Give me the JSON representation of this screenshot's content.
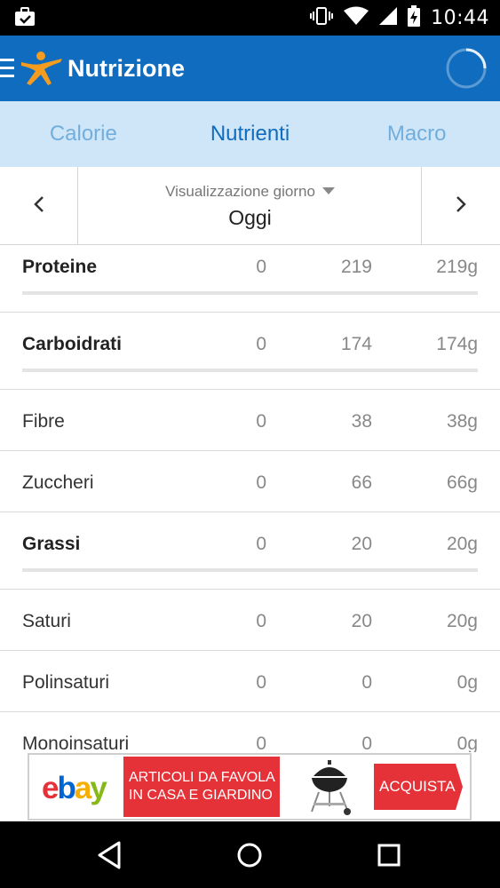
{
  "status_bar": {
    "time": "10:44",
    "icons": [
      "briefcase-check-icon",
      "vibrate-icon",
      "wifi-icon",
      "signal-icon",
      "battery-charging-icon"
    ]
  },
  "app_bar": {
    "title": "Nutrizione",
    "menu_icon": "hamburger-icon",
    "logo_icon": "runner-logo-icon",
    "status_icon": "loading-spinner-icon",
    "color": "#0f6cbf"
  },
  "tabs": [
    {
      "label": "Calorie",
      "active": false
    },
    {
      "label": "Nutrienti",
      "active": true
    },
    {
      "label": "Macro",
      "active": false
    }
  ],
  "day_selector": {
    "label": "Visualizzazione giorno",
    "value": "Oggi"
  },
  "nutrients": [
    {
      "name": "Proteine",
      "total": "0",
      "goal": "219",
      "left": "219g",
      "main": true
    },
    {
      "name": "Carboidrati",
      "total": "0",
      "goal": "174",
      "left": "174g",
      "main": true
    },
    {
      "name": "Fibre",
      "total": "0",
      "goal": "38",
      "left": "38g",
      "main": false
    },
    {
      "name": "Zuccheri",
      "total": "0",
      "goal": "66",
      "left": "66g",
      "main": false
    },
    {
      "name": "Grassi",
      "total": "0",
      "goal": "20",
      "left": "20g",
      "main": true
    },
    {
      "name": "Saturi",
      "total": "0",
      "goal": "20",
      "left": "20g",
      "main": false
    },
    {
      "name": "Polinsaturi",
      "total": "0",
      "goal": "0",
      "left": "0g",
      "main": false
    },
    {
      "name": "Monoinsaturi",
      "total": "0",
      "goal": "0",
      "left": "0g",
      "main": false
    }
  ],
  "ad": {
    "brand_e": "e",
    "brand_b": "b",
    "brand_a": "a",
    "brand_y": "y",
    "line1": "ARTICOLI DA FAVOLA",
    "line2": "IN CASA E GIARDINO",
    "cta": "ACQUISTA",
    "image_icon": "barbecue-grill-icon"
  },
  "nav_bar": {
    "icons": [
      "back-icon",
      "home-icon",
      "recents-icon"
    ]
  }
}
